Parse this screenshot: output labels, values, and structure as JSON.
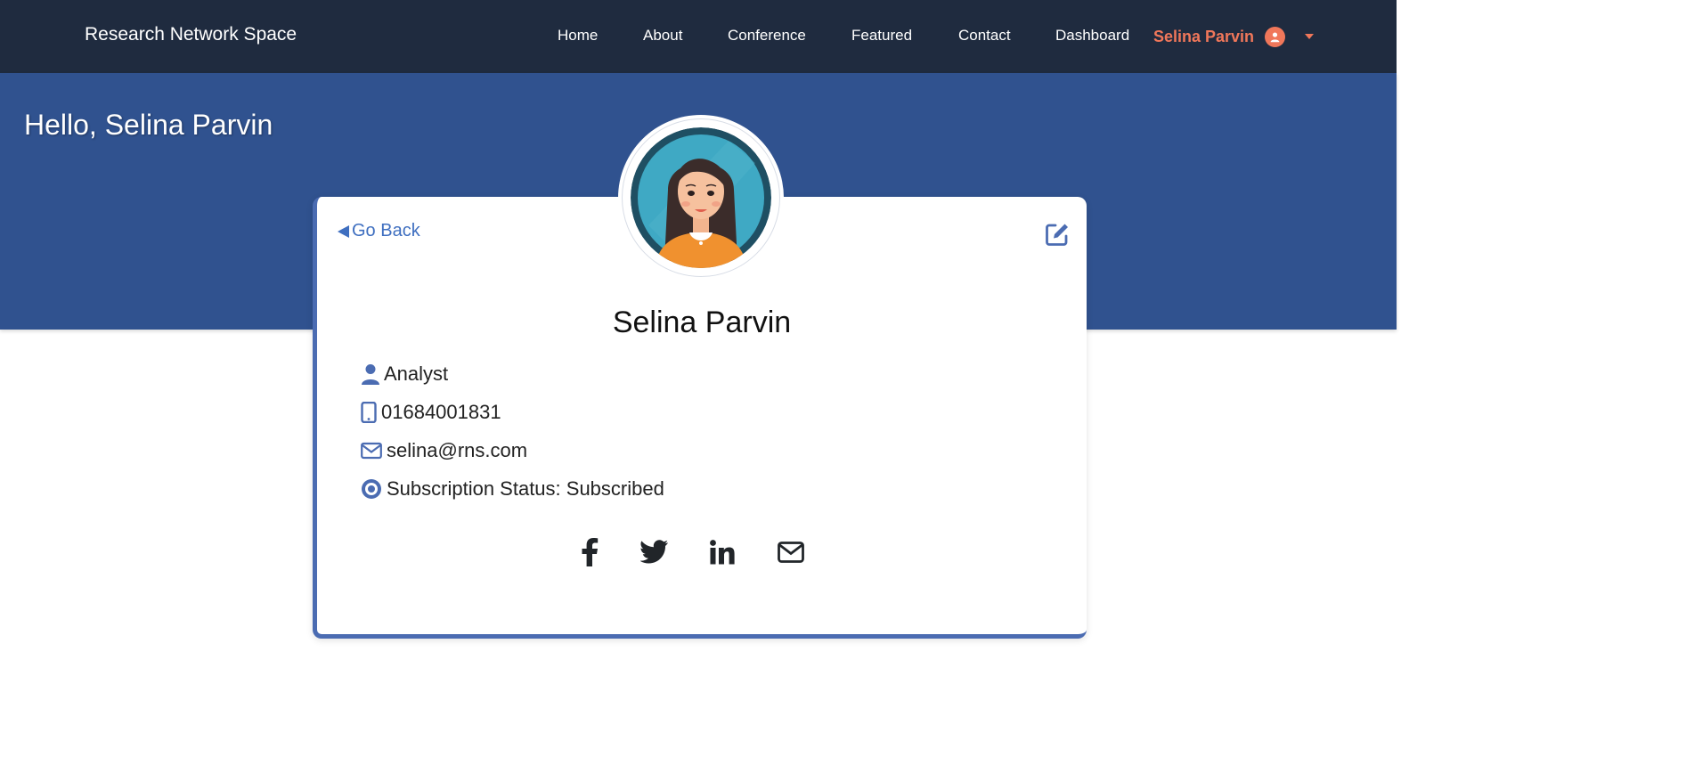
{
  "navbar": {
    "brand": "Research Network Space",
    "links": [
      "Home",
      "About",
      "Conference",
      "Featured",
      "Contact",
      "Dashboard"
    ],
    "user_name": "Selina Parvin"
  },
  "hero": {
    "greeting": "Hello, Selina Parvin"
  },
  "profile": {
    "go_back": "Go Back",
    "name": "Selina Parvin",
    "role": "Analyst",
    "phone": "01684001831",
    "email": "selina@rns.com",
    "subscription": "Subscription Status: Subscribed"
  },
  "social": [
    "facebook-icon",
    "twitter-icon",
    "linkedin-icon",
    "mail-icon"
  ],
  "colors": {
    "navbar_bg": "#1f2b3f",
    "hero_bg": "#30528f",
    "accent": "#f0775a",
    "link": "#3f6fc0",
    "icon": "#4b6cb2"
  }
}
